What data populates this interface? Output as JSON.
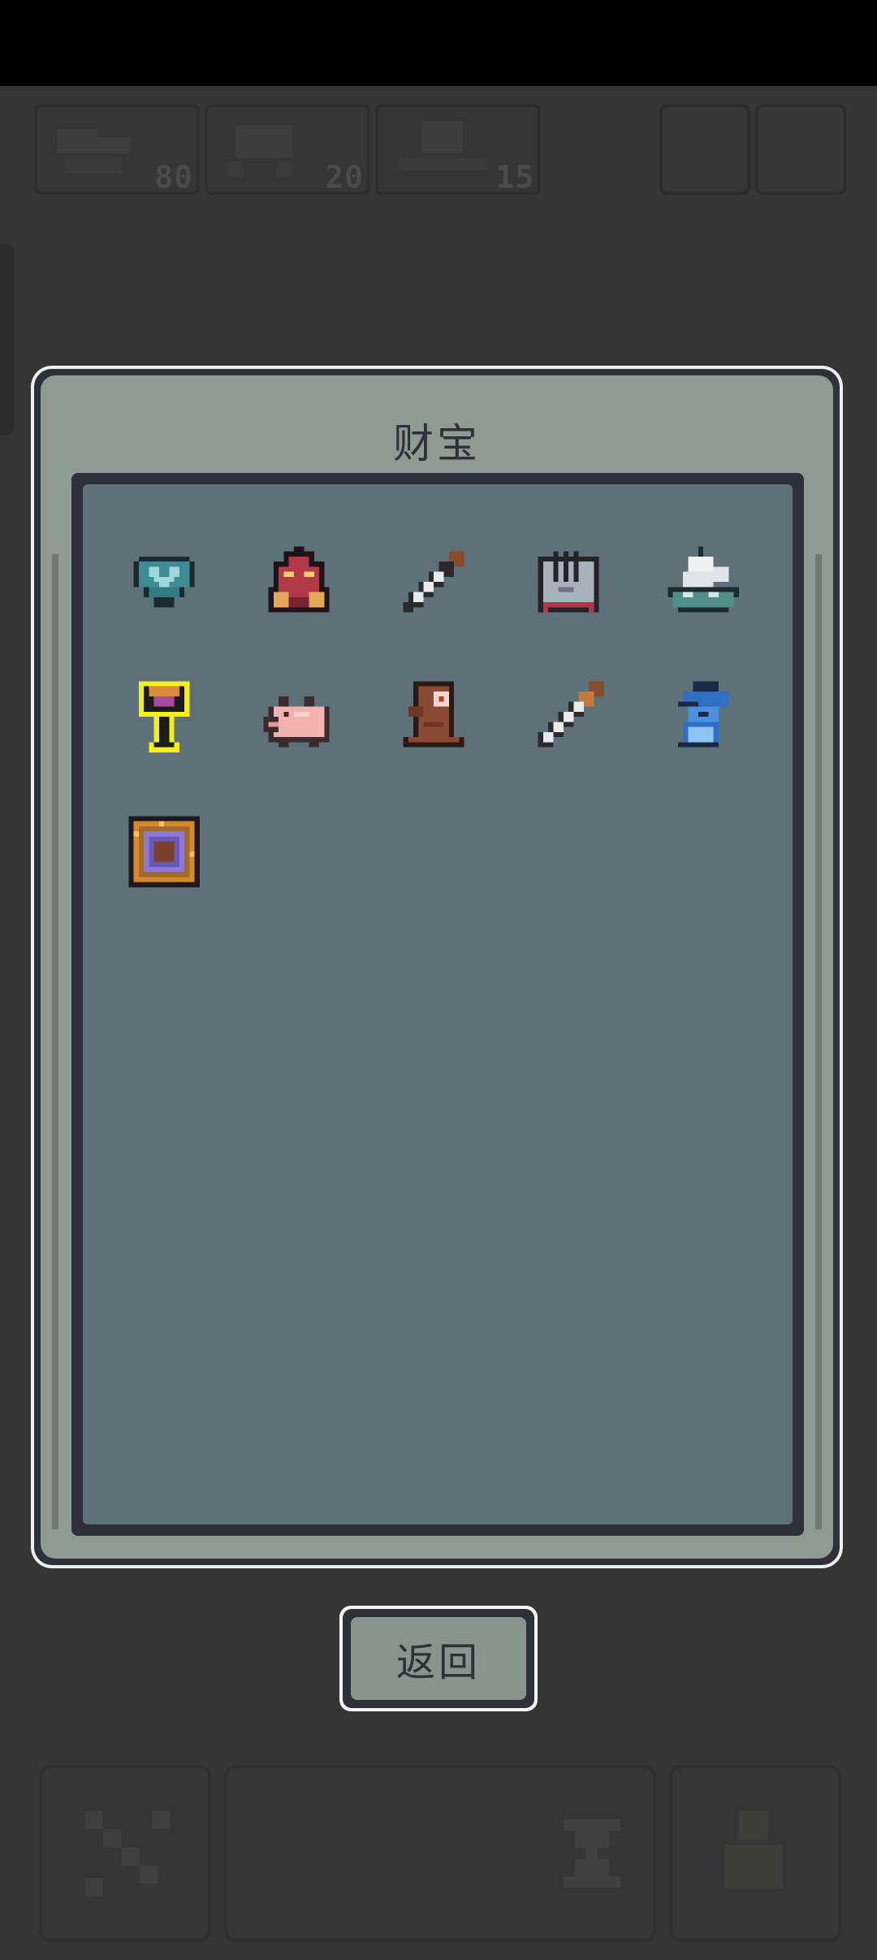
{
  "resources": [
    {
      "count": "80",
      "icon": "drill-icon"
    },
    {
      "count": "20",
      "icon": "cart-icon"
    },
    {
      "count": "15",
      "icon": "skull-icon"
    }
  ],
  "panel": {
    "title": "财宝",
    "treasures": [
      {
        "name": "teal-heart-gem-icon"
      },
      {
        "name": "red-demon-mask-icon"
      },
      {
        "name": "short-dagger-icon"
      },
      {
        "name": "stone-gauntlet-icon"
      },
      {
        "name": "sailing-ship-icon"
      },
      {
        "name": "golden-chalice-icon"
      },
      {
        "name": "pink-piggy-icon"
      },
      {
        "name": "brown-totem-icon"
      },
      {
        "name": "long-sword-icon"
      },
      {
        "name": "blue-wizard-icon"
      },
      {
        "name": "rune-portal-tablet-icon"
      }
    ]
  },
  "back_button": {
    "label": "返回"
  },
  "colors": {
    "panel_bg": "#8e9b93",
    "inner_bg": "#5e7179",
    "frame_dark": "#2f3139",
    "page_bg": "#353535"
  }
}
